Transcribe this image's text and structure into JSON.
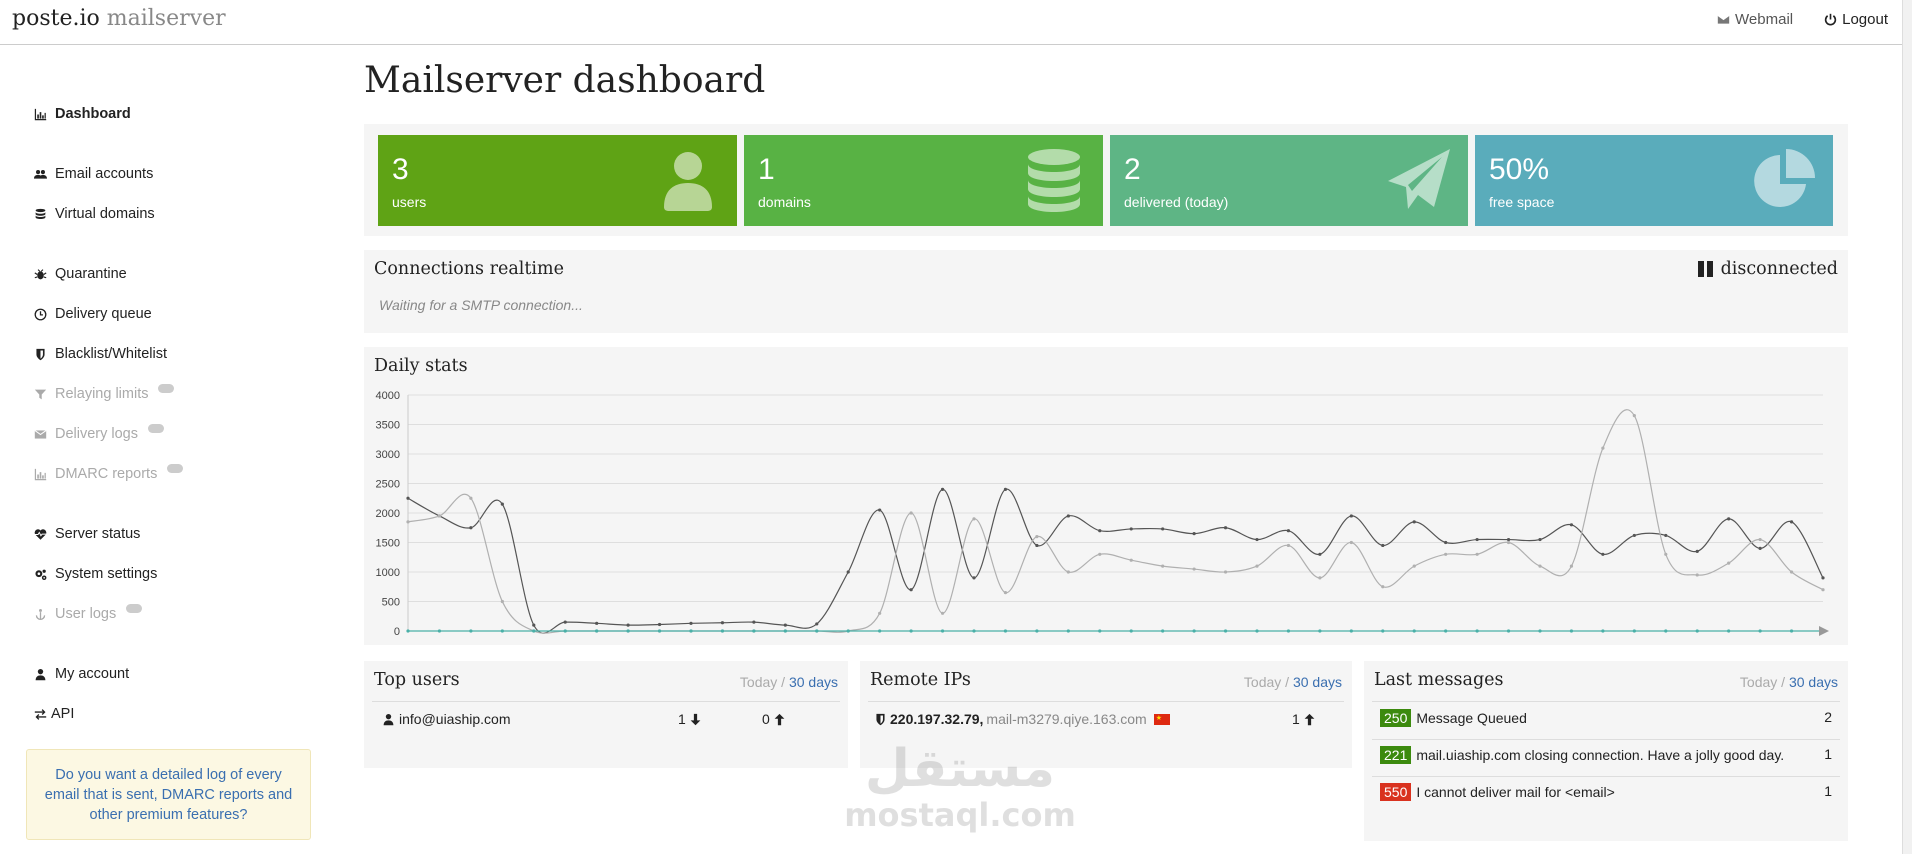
{
  "header": {
    "brand": "poste.io",
    "brand_sub": " mailserver",
    "webmail": "Webmail",
    "logout": "Logout"
  },
  "sidebar": {
    "items": [
      {
        "label": "Dashboard",
        "icon": "bar-chart-icon"
      },
      {
        "label": "Email accounts",
        "icon": "users-icon"
      },
      {
        "label": "Virtual domains",
        "icon": "database-icon"
      },
      {
        "label": "Quarantine",
        "icon": "bug-icon"
      },
      {
        "label": "Delivery queue",
        "icon": "clock-icon"
      },
      {
        "label": "Blacklist/Whitelist",
        "icon": "shield-icon"
      },
      {
        "label": "Relaying limits",
        "icon": "filter-icon"
      },
      {
        "label": "Delivery logs",
        "icon": "envelope-icon"
      },
      {
        "label": "DMARC reports",
        "icon": "bar-chart-icon"
      },
      {
        "label": "Server status",
        "icon": "heartbeat-icon"
      },
      {
        "label": "System settings",
        "icon": "cogs-icon"
      },
      {
        "label": "User logs",
        "icon": "anchor-icon"
      },
      {
        "label": "My account",
        "icon": "user-icon"
      },
      {
        "label": "API",
        "icon": "exchange-icon"
      }
    ],
    "promo": "Do you want a detailed log of every email that is sent, DMARC reports and other premium features?"
  },
  "main": {
    "title": "Mailserver dashboard",
    "tiles": [
      {
        "value": "3",
        "label": "users",
        "color": "#5fa315",
        "icon": "user-icon"
      },
      {
        "value": "1",
        "label": "domains",
        "color": "#58b244",
        "icon": "database-icon"
      },
      {
        "value": "2",
        "label": "delivered (today)",
        "color": "#5eb585",
        "icon": "paper-plane-icon"
      },
      {
        "value": "50%",
        "label": "free space",
        "color": "#5aacbb",
        "icon": "pie-chart-icon"
      }
    ],
    "connections": {
      "title": "Connections realtime",
      "status": "disconnected",
      "message": "Waiting for a SMTP connection..."
    },
    "daily_title": "Daily stats",
    "top_users": {
      "title": "Top users",
      "today": "Today",
      "sep": " / ",
      "thirty": "30 days",
      "rows": [
        {
          "user": "info@uiaship.com",
          "down": "1",
          "up": "0"
        }
      ]
    },
    "remote_ips": {
      "title": "Remote IPs",
      "today": "Today",
      "sep": " / ",
      "thirty": "30 days",
      "rows": [
        {
          "ip": "220.197.32.79,",
          "host": " mail-m3279.qiye.163.com",
          "count": "1"
        }
      ]
    },
    "last_messages": {
      "title": "Last messages",
      "today": "Today",
      "sep": " / ",
      "thirty": "30 days",
      "rows": [
        {
          "code": "250",
          "color": "#3c8a0e",
          "text": "Message Queued",
          "count": "2"
        },
        {
          "code": "221",
          "color": "#3c8a0e",
          "text": "mail.uiaship.com closing connection. Have a jolly good day.",
          "count": "1"
        },
        {
          "code": "550",
          "color": "#d9321f",
          "text": "I cannot deliver mail for <email>",
          "count": "1"
        }
      ]
    }
  },
  "watermark": {
    "arabic": "مستقل",
    "latin": "mostaql.com"
  },
  "chart_data": {
    "type": "line",
    "ylim": [
      0,
      4000
    ],
    "yticks": [
      "4000",
      "3500",
      "3000",
      "2500",
      "2000",
      "1500",
      "1000",
      "500",
      "0"
    ],
    "grid": true,
    "series": [
      {
        "color": "#555555",
        "values": [
          2250,
          1950,
          1750,
          2150,
          100,
          150,
          130,
          100,
          110,
          130,
          140,
          150,
          100,
          120,
          1000,
          2050,
          700,
          2400,
          900,
          2400,
          1450,
          1950,
          1700,
          1730,
          1730,
          1650,
          1750,
          1550,
          1700,
          1300,
          1950,
          1450,
          1850,
          1500,
          1550,
          1550,
          1550,
          1800,
          1300,
          1620,
          1620,
          1350,
          1900,
          1400,
          1850,
          900
        ]
      },
      {
        "color": "#b0b0b0",
        "values": [
          1850,
          1950,
          2250,
          500,
          0,
          0,
          0,
          0,
          0,
          0,
          0,
          0,
          0,
          0,
          0,
          300,
          2000,
          300,
          1900,
          650,
          1600,
          1000,
          1300,
          1200,
          1100,
          1050,
          1000,
          1100,
          1450,
          900,
          1500,
          750,
          1100,
          1300,
          1300,
          1500,
          1100,
          1100,
          3100,
          3650,
          1300,
          950,
          1150,
          1550,
          1000,
          700
        ]
      },
      {
        "color": "#4ab0a8",
        "values": [
          0,
          0,
          0,
          0,
          0,
          0,
          0,
          0,
          0,
          0,
          0,
          0,
          0,
          0,
          0,
          0,
          0,
          0,
          0,
          0,
          0,
          0,
          0,
          0,
          0,
          0,
          0,
          0,
          0,
          0,
          0,
          0,
          0,
          0,
          0,
          0,
          0,
          0,
          0,
          0,
          0,
          0,
          0,
          0,
          0,
          0
        ]
      }
    ]
  }
}
